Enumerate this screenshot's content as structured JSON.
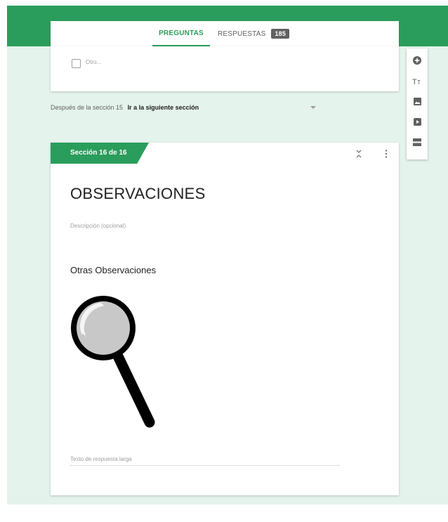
{
  "tabs": {
    "questions_label": "PREGUNTAS",
    "responses_label": "RESPUESTAS",
    "responses_count": "185"
  },
  "prev_card": {
    "other_option_label": "Otro..."
  },
  "after_section": {
    "label": "Después de la sección 15",
    "goto_value": "Ir a la siguiente sección"
  },
  "toolbar": {
    "icons": [
      "add-question-icon",
      "add-title-icon",
      "add-image-icon",
      "add-video-icon",
      "add-section-icon"
    ]
  },
  "section": {
    "tab_label": "Sección 16 de 16",
    "title": "OBSERVACIONES",
    "description_placeholder": "Descripción (opcional)"
  },
  "question": {
    "title": "Otras Observaciones",
    "image_icon": "magnifying-glass-image",
    "answer_placeholder": "Texto de respuesta larga"
  },
  "colors": {
    "brand_green": "#2a9d5c",
    "background": "#e4f3ec"
  }
}
